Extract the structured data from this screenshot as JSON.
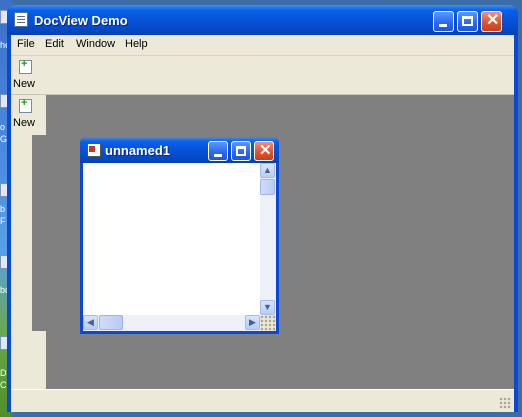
{
  "desktop": {
    "fragments": [
      "he",
      "o",
      "G",
      "b",
      "F",
      "bo",
      "D",
      "Cle"
    ]
  },
  "frame": {
    "title": "DocView Demo",
    "menu": [
      "File",
      "Edit",
      "Window",
      "Help"
    ],
    "toolbar_new_label": "New",
    "side_new_label": "New"
  },
  "child": {
    "title": "unnamed1"
  },
  "icons": {
    "app": "document-icon",
    "new": "new-document-icon",
    "child": "mdi-document-icon"
  },
  "colors": {
    "titlebar": "#0553d8",
    "close": "#e0542c",
    "mdi_background": "#808080",
    "face": "#ece9d8"
  }
}
